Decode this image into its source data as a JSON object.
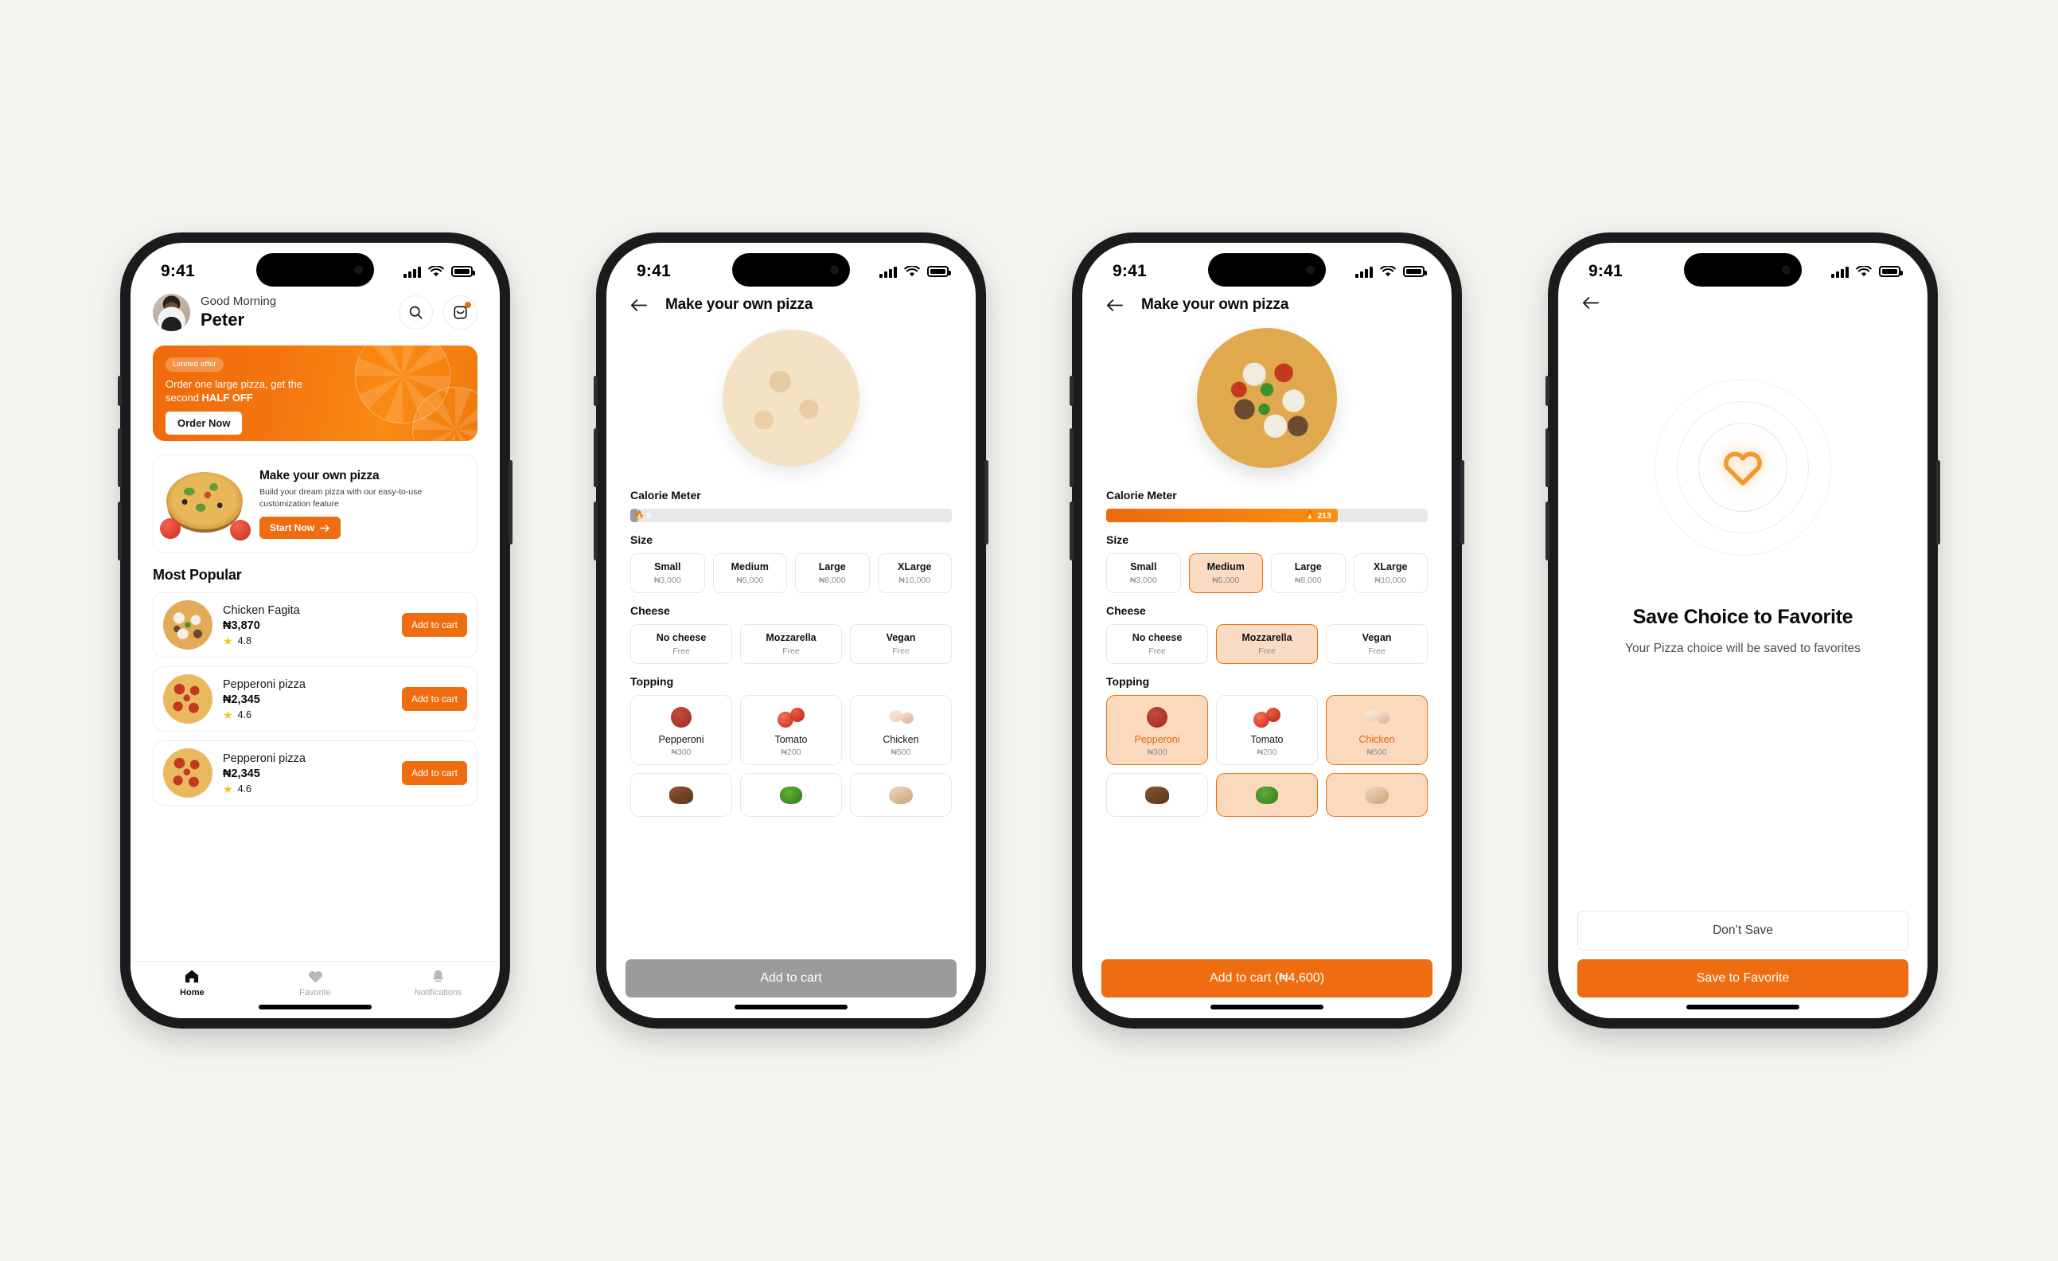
{
  "status_bar": {
    "time": "9:41",
    "signal_icon": "cellular-bars-icon",
    "wifi_icon": "wifi-icon",
    "battery_icon": "battery-icon"
  },
  "colors": {
    "accent": "#ef6d10",
    "accent_soft": "#fbd9bd",
    "disabled": "#9b9b9b",
    "page_bg": "#f4f3ef",
    "star": "#f5c31c"
  },
  "home": {
    "greeting": "Good Morning",
    "user_name": "Peter",
    "search_icon": "search-icon",
    "inbox_icon": "inbox-icon",
    "promo": {
      "tag": "Limited offer",
      "line1": "Order one large pizza, get the",
      "line2_prefix": "second ",
      "line2_strong": "HALF OFF",
      "button": "Order Now"
    },
    "build_card": {
      "title": "Make your own pizza",
      "description": "Build your dream pizza with our easy-to-use customization feature",
      "button": "Start Now",
      "button_icon": "arrow-right-icon"
    },
    "section_title": "Most  Popular",
    "products": [
      {
        "name": "Chicken Fagita",
        "price": "₦3,870",
        "rating": "4.8",
        "action": "Add to cart"
      },
      {
        "name": "Pepperoni pizza",
        "price": "₦2,345",
        "rating": "4.6",
        "action": "Add to cart"
      },
      {
        "name": "Pepperoni pizza",
        "price": "₦2,345",
        "rating": "4.6",
        "action": "Add to cart"
      }
    ],
    "tabs": [
      {
        "label": "Home",
        "icon": "home-icon",
        "active": true
      },
      {
        "label": "Favorite",
        "icon": "heart-icon",
        "active": false
      },
      {
        "label": "Notifications",
        "icon": "bell-icon",
        "active": false
      }
    ]
  },
  "builder_empty": {
    "title": "Make your own pizza",
    "back_icon": "arrow-left-icon",
    "calorie_label": "Calorie Meter",
    "calorie_value": "0",
    "calorie_percent": 2,
    "calorie_icon": "flame-icon",
    "size_label": "Size",
    "sizes": [
      {
        "name": "Small",
        "price": "₦3,000",
        "selected": false
      },
      {
        "name": "Medium",
        "price": "₦5,000",
        "selected": false
      },
      {
        "name": "Large",
        "price": "₦8,000",
        "selected": false
      },
      {
        "name": "XLarge",
        "price": "₦10,000",
        "selected": false
      }
    ],
    "cheese_label": "Cheese",
    "cheeses": [
      {
        "name": "No cheese",
        "price": "Free",
        "selected": false
      },
      {
        "name": "Mozzarella",
        "price": "Free",
        "selected": false
      },
      {
        "name": "Vegan",
        "price": "Free",
        "selected": false
      }
    ],
    "topping_label": "Topping",
    "toppings": [
      {
        "name": "Pepperoni",
        "price": "₦300",
        "icon": "pepperoni-icon",
        "selected": false
      },
      {
        "name": "Tomato",
        "price": "₦200",
        "icon": "tomato-icon",
        "selected": false
      },
      {
        "name": "Chicken",
        "price": "₦500",
        "icon": "chicken-icon",
        "selected": false
      }
    ],
    "toppings_row2": [
      {
        "icon": "beef-icon",
        "selected": false
      },
      {
        "icon": "broccoli-icon",
        "selected": false
      },
      {
        "icon": "mushroom-icon",
        "selected": false
      }
    ],
    "cta": "Add to cart",
    "cta_enabled": false
  },
  "builder_filled": {
    "title": "Make your own pizza",
    "back_icon": "arrow-left-icon",
    "calorie_label": "Calorie Meter",
    "calorie_value": "213",
    "calorie_percent": 72,
    "calorie_icon": "flame-icon",
    "size_label": "Size",
    "sizes": [
      {
        "name": "Small",
        "price": "₦3,000",
        "selected": false
      },
      {
        "name": "Medium",
        "price": "₦5,000",
        "selected": true
      },
      {
        "name": "Large",
        "price": "₦8,000",
        "selected": false
      },
      {
        "name": "XLarge",
        "price": "₦10,000",
        "selected": false
      }
    ],
    "cheese_label": "Cheese",
    "cheeses": [
      {
        "name": "No cheese",
        "price": "Free",
        "selected": false
      },
      {
        "name": "Mozzarella",
        "price": "Free",
        "selected": true
      },
      {
        "name": "Vegan",
        "price": "Free",
        "selected": false
      }
    ],
    "topping_label": "Topping",
    "toppings": [
      {
        "name": "Pepperoni",
        "price": "₦300",
        "icon": "pepperoni-icon",
        "selected": true
      },
      {
        "name": "Tomato",
        "price": "₦200",
        "icon": "tomato-icon",
        "selected": false
      },
      {
        "name": "Chicken",
        "price": "₦500",
        "icon": "chicken-icon",
        "selected": true
      }
    ],
    "toppings_row2": [
      {
        "icon": "beef-icon",
        "selected": false
      },
      {
        "icon": "broccoli-icon",
        "selected": true
      },
      {
        "icon": "mushroom-icon",
        "selected": true
      }
    ],
    "cta": "Add to cart (₦4,600)",
    "cta_enabled": true
  },
  "favorite": {
    "back_icon": "arrow-left-icon",
    "heart_icon": "heart-outline-icon",
    "title": "Save Choice to Favorite",
    "subtitle": "Your Pizza choice will be saved to favorites",
    "secondary_button": "Don’t Save",
    "primary_button": "Save to Favorite"
  }
}
